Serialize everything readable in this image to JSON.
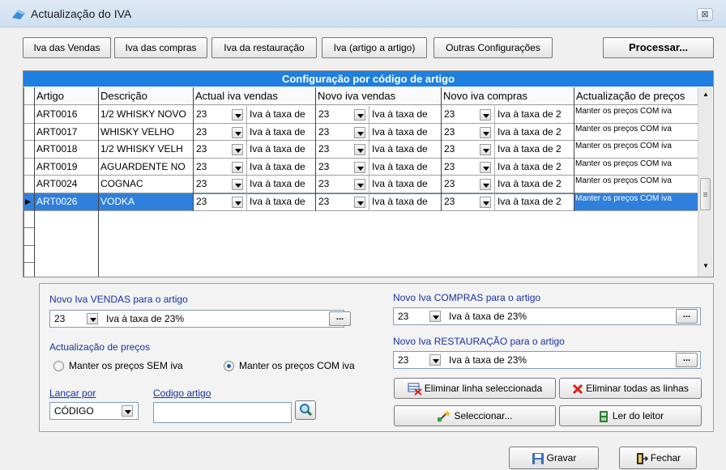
{
  "window": {
    "title": "Actualização do IVA",
    "close_glyph": "⊠"
  },
  "toolbar": {
    "iva_vendas": "Iva das Vendas",
    "iva_compras": "Iva das compras",
    "iva_restauracao": "Iva da restauração",
    "iva_artigo": "Iva (artigo a artigo)",
    "outras_config": "Outras Configurações",
    "processar": "Processar..."
  },
  "grid": {
    "caption": "Configuração por código de artigo",
    "columns": [
      "Artigo",
      "Descrição",
      "Actual iva vendas",
      "Novo iva vendas",
      "Novo iva compras",
      "Actualização de preços"
    ],
    "rows": [
      {
        "artigo": "ART0016",
        "descricao": "1/2 WHISKY NOVO",
        "iva_vendas": "23",
        "iva_vendas_desc": "Iva à taxa de",
        "novo_vendas": "23",
        "novo_vendas_desc": "Iva à taxa de",
        "novo_compras": "23",
        "novo_compras_desc": "Iva à taxa de 2",
        "precos": "Manter os preços COM iva",
        "selected": false
      },
      {
        "artigo": "ART0017",
        "descricao": "WHISKY VELHO",
        "iva_vendas": "23",
        "iva_vendas_desc": "Iva à taxa de",
        "novo_vendas": "23",
        "novo_vendas_desc": "Iva à taxa de",
        "novo_compras": "23",
        "novo_compras_desc": "Iva à taxa de 2",
        "precos": "Manter os preços COM iva",
        "selected": false
      },
      {
        "artigo": "ART0018",
        "descricao": "1/2 WHISKY VELH",
        "iva_vendas": "23",
        "iva_vendas_desc": "Iva à taxa de",
        "novo_vendas": "23",
        "novo_vendas_desc": "Iva à taxa de",
        "novo_compras": "23",
        "novo_compras_desc": "Iva à taxa de 2",
        "precos": "Manter os preços COM iva",
        "selected": false
      },
      {
        "artigo": "ART0019",
        "descricao": "AGUARDENTE NO",
        "iva_vendas": "23",
        "iva_vendas_desc": "Iva à taxa de",
        "novo_vendas": "23",
        "novo_vendas_desc": "Iva à taxa de",
        "novo_compras": "23",
        "novo_compras_desc": "Iva à taxa de 2",
        "precos": "Manter os preços COM iva",
        "selected": false
      },
      {
        "artigo": "ART0024",
        "descricao": "COGNAC",
        "iva_vendas": "23",
        "iva_vendas_desc": "Iva à taxa de",
        "novo_vendas": "23",
        "novo_vendas_desc": "Iva à taxa de",
        "novo_compras": "23",
        "novo_compras_desc": "Iva à taxa de 2",
        "precos": "Manter os preços COM iva",
        "selected": false
      },
      {
        "artigo": "ART0026",
        "descricao": "VODKA",
        "iva_vendas": "23",
        "iva_vendas_desc": "Iva à taxa de",
        "novo_vendas": "23",
        "novo_vendas_desc": "Iva à taxa de",
        "novo_compras": "23",
        "novo_compras_desc": "Iva à taxa de 2",
        "precos": "Manter os preços COM iva",
        "selected": true
      }
    ]
  },
  "panel": {
    "vendas_label": "Novo Iva VENDAS para o artigo",
    "vendas_code": "23",
    "vendas_desc": "Iva à taxa de 23%",
    "compras_label": "Novo Iva COMPRAS para o artigo",
    "compras_code": "23",
    "compras_desc": "Iva à taxa de 23%",
    "restauracao_label": "Novo Iva RESTAURAÇÃO para o artigo",
    "restauracao_code": "23",
    "restauracao_desc": "Iva à taxa de 23%",
    "dots": "...",
    "precos_label": "Actualização de preços",
    "radio_sem": "Manter os preços SEM iva",
    "radio_com": "Manter os preços COM iva",
    "radio_selected": "com",
    "lancar_label": "Lançar por",
    "lancar_value": "CÓDIGO",
    "codigo_label": "Codigo artigo",
    "codigo_value": "",
    "btn_eliminar_linha": "Eliminar linha seleccionada",
    "btn_eliminar_todas": "Eliminar todas as linhas",
    "btn_seleccionar": "Seleccionar...",
    "btn_ler_leitor": "Ler do leitor"
  },
  "footer": {
    "gravar": "Gravar",
    "fechar": "Fechar"
  },
  "colors": {
    "accent": "#1e7fe0",
    "selection": "#2f80dc",
    "label_blue": "#1a2fa5",
    "delete_red": "#d8231a"
  }
}
